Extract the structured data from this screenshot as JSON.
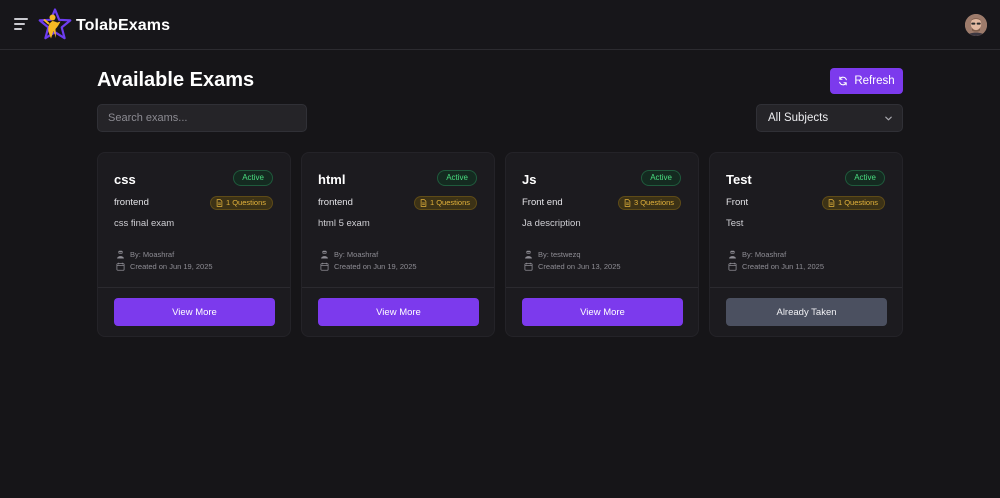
{
  "app": {
    "brand": "TolabExams"
  },
  "header": {
    "title": "Available Exams",
    "refresh_label": "Refresh"
  },
  "filters": {
    "search_placeholder": "Search exams...",
    "subject_value": "All Subjects"
  },
  "colors": {
    "accent": "#7c3aed",
    "active_green": "#4ade80",
    "questions_amber": "#e4b33c",
    "taken_gray": "#4b5060",
    "background": "#161518"
  },
  "exams": [
    {
      "title": "css",
      "status": "Active",
      "subject": "frontend",
      "questions": "1 Questions",
      "description": "css final exam",
      "author": "By: Moashraf",
      "created": "Created on Jun 19, 2025",
      "action": "View More",
      "action_state": "available"
    },
    {
      "title": "html",
      "status": "Active",
      "subject": "frontend",
      "questions": "1 Questions",
      "description": "html 5 exam",
      "author": "By: Moashraf",
      "created": "Created on Jun 19, 2025",
      "action": "View More",
      "action_state": "available"
    },
    {
      "title": "Js",
      "status": "Active",
      "subject": "Front end",
      "questions": "3 Questions",
      "description": "Ja description",
      "author": "By: testwezq",
      "created": "Created on Jun 13, 2025",
      "action": "View More",
      "action_state": "available"
    },
    {
      "title": "Test",
      "status": "Active",
      "subject": "Front",
      "questions": "1 Questions",
      "description": "Test",
      "author": "By: Moashraf",
      "created": "Created on Jun 11, 2025",
      "action": "Already Taken",
      "action_state": "taken"
    }
  ]
}
